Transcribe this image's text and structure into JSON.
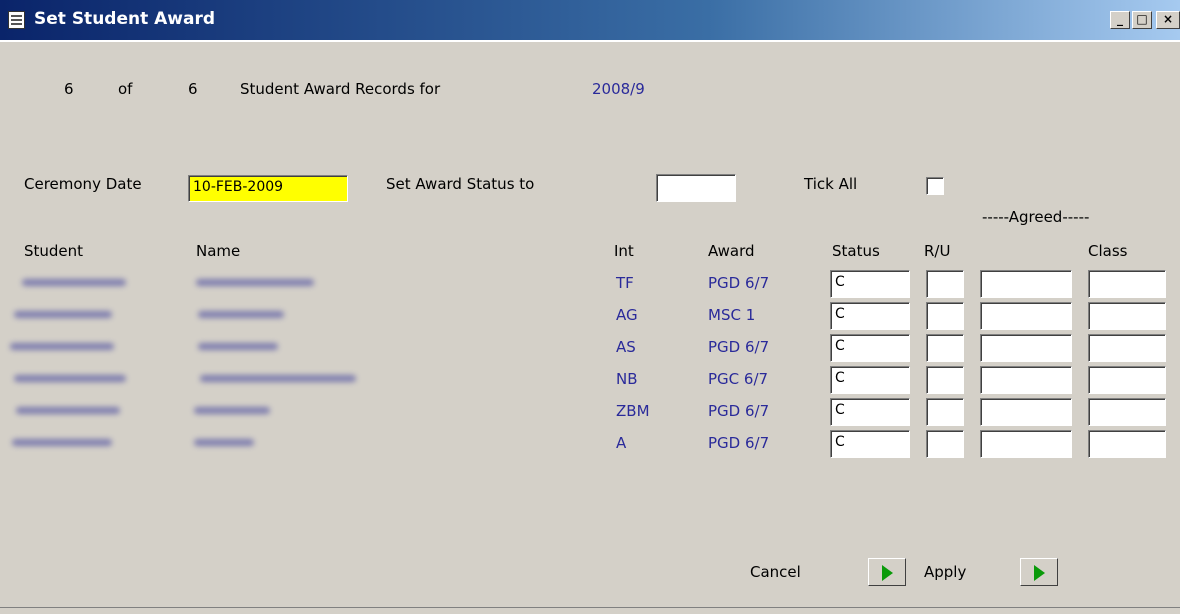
{
  "window": {
    "title": "Set Student Award",
    "min": "_",
    "max": "□",
    "close": "×"
  },
  "header": {
    "current": "6",
    "of_label": "of",
    "total": "6",
    "records_label": "Student Award Records for",
    "year": "2008/9"
  },
  "controls": {
    "ceremony_label": "Ceremony Date",
    "ceremony_value": "10-FEB-2009",
    "set_status_label": "Set Award Status to",
    "set_status_value": "",
    "tick_all_label": "Tick All",
    "agreed_label": "-----Agreed-----"
  },
  "columns": {
    "student": "Student",
    "name": "Name",
    "int": "Int",
    "award": "Award",
    "status": "Status",
    "ru": "R/U",
    "class": "Class"
  },
  "rows": [
    {
      "int": "TF",
      "award": "PGD 6/7",
      "status": "C",
      "ru": "",
      "agreed": "",
      "class": ""
    },
    {
      "int": "AG",
      "award": "MSC 1",
      "status": "C",
      "ru": "",
      "agreed": "",
      "class": ""
    },
    {
      "int": "AS",
      "award": "PGD 6/7",
      "status": "C",
      "ru": "",
      "agreed": "",
      "class": ""
    },
    {
      "int": "NB",
      "award": "PGC 6/7",
      "status": "C",
      "ru": "",
      "agreed": "",
      "class": ""
    },
    {
      "int": "ZBM",
      "award": "PGD 6/7",
      "status": "C",
      "ru": "",
      "agreed": "",
      "class": ""
    },
    {
      "int": "A",
      "award": "PGD 6/7",
      "status": "C",
      "ru": "",
      "agreed": "",
      "class": ""
    }
  ],
  "footer": {
    "cancel_label": "Cancel",
    "apply_label": "Apply"
  },
  "icons": {
    "window": "window-form-icon",
    "action": "green-play-arrow-icon"
  },
  "colors": {
    "title_bar": "#0a246a",
    "highlight_field": "#ffff00",
    "text_blue": "#2a2a9a",
    "arrow_green": "#0a9a0a"
  }
}
